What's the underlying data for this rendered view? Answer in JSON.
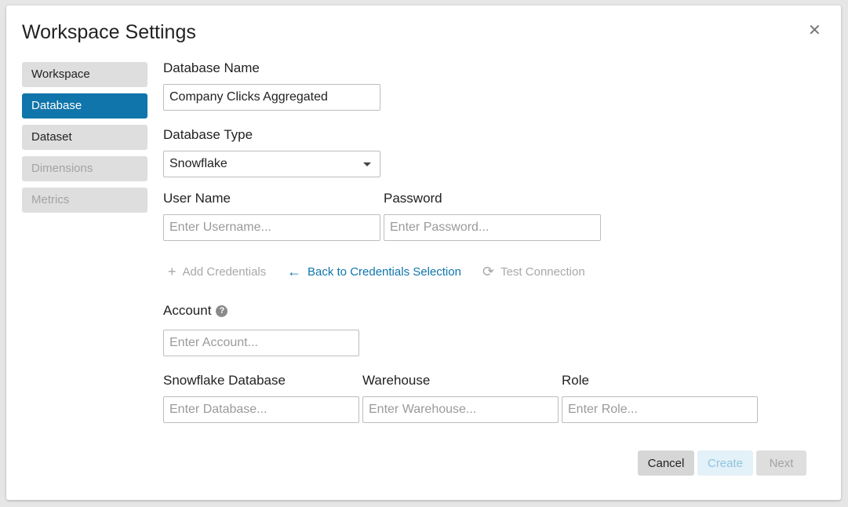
{
  "dialog": {
    "title": "Workspace Settings",
    "close_icon": "close-icon"
  },
  "sidebar": {
    "items": [
      {
        "label": "Workspace",
        "state": "normal"
      },
      {
        "label": "Database",
        "state": "active"
      },
      {
        "label": "Dataset",
        "state": "normal"
      },
      {
        "label": "Dimensions",
        "state": "disabled"
      },
      {
        "label": "Metrics",
        "state": "disabled"
      }
    ]
  },
  "form": {
    "database_name": {
      "label": "Database Name",
      "value": "Company Clicks Aggregated"
    },
    "database_type": {
      "label": "Database Type",
      "value": "Snowflake"
    },
    "username": {
      "label": "User Name",
      "placeholder": "Enter Username..."
    },
    "password": {
      "label": "Password",
      "placeholder": "Enter Password..."
    },
    "account": {
      "label": "Account",
      "placeholder": "Enter Account...",
      "help_icon": "?"
    },
    "snowflake_database": {
      "label": "Snowflake Database",
      "placeholder": "Enter Database..."
    },
    "warehouse": {
      "label": "Warehouse",
      "placeholder": "Enter Warehouse..."
    },
    "role": {
      "label": "Role",
      "placeholder": "Enter Role..."
    }
  },
  "actions": {
    "add_credentials": {
      "icon": "+",
      "label": "Add Credentials"
    },
    "back_to_credentials": {
      "icon": "←",
      "label": "Back to Credentials Selection"
    },
    "test_connection": {
      "icon": "⟳",
      "label": "Test Connection"
    }
  },
  "footer": {
    "cancel": "Cancel",
    "create": "Create",
    "next": "Next"
  },
  "colors": {
    "accent": "#0f75ab",
    "nav_bg": "#dedede",
    "create_bg": "#e3f1f8"
  }
}
